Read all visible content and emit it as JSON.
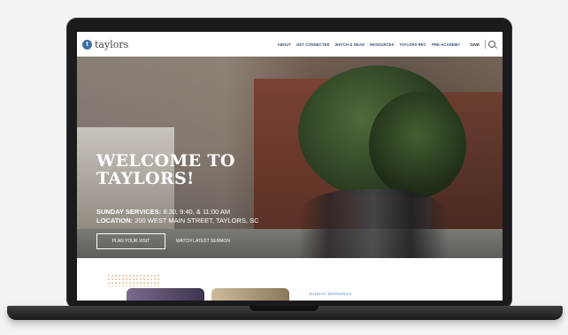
{
  "nav": {
    "logo_mark": "t",
    "logo_text": "taylors",
    "menu": [
      "ABOUT",
      "GET CONNECTED",
      "WATCH & READ",
      "RESOURCES",
      "TAYLORS REC",
      "PRE-ACADEMY"
    ],
    "give": "GIVE"
  },
  "hero": {
    "headline_line1": "WELCOME TO",
    "headline_line2": "TAYLORS!",
    "services_label": "SUNDAY SERVICES:",
    "services_value": "8:30, 9:40, & 11:00 AM",
    "location_label": "LOCATION:",
    "location_value": "200 WEST MAIN STREET, TAYLORS, SC",
    "plan_button": "PLAN YOUR VISIT",
    "watch_link": "WATCH LATEST SERMON"
  },
  "below": {
    "section_label": "SUNDAY MORNINGS"
  }
}
